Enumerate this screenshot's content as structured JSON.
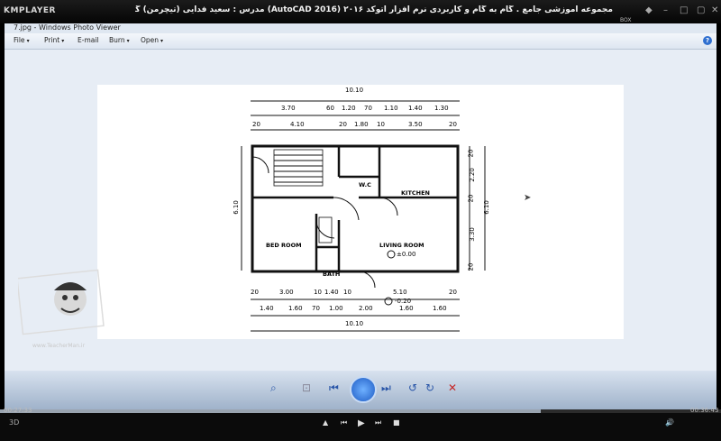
{
  "player": {
    "logo": "KMPLAYER",
    "title": "مجموعه آموزشی جامع . گام به گام و کاربردی نرم افزار  اتوکد ۲۰۱۶ (AutoCAD 2016)  مدرس : سعید فدایی (تیچرمن) گروه آموزشی پادشاه گرافیست ها",
    "box_label": "BOX",
    "time_elapsed": "00:27:33",
    "time_total": "00:36:43",
    "progress": 0.75
  },
  "viewer": {
    "title": "7.jpg - Windows Photo Viewer",
    "menu": [
      "File",
      "Print",
      "E-mail",
      "Burn",
      "Open"
    ],
    "help": "?"
  },
  "plan": {
    "top_dims_total": "10.10",
    "top_dims_row1": [
      "3.70",
      "60",
      "1.20",
      "70",
      "1.10",
      "1.40",
      "1.30"
    ],
    "top_dims_row2": [
      "20",
      "4.10",
      "20",
      "1.80",
      "10",
      "3.50",
      "20"
    ],
    "bottom_dims_row1": [
      "20",
      "3.00",
      "10",
      "1.40",
      "10",
      "5.10",
      "20"
    ],
    "bottom_dims_row2": [
      "1.40",
      "1.60",
      "70",
      "1.00",
      "2.00",
      "1.60",
      "1.60"
    ],
    "bottom_dims_total": "10.10",
    "left_dim": "6.10",
    "right_dims_row1": [
      "20",
      "2.20",
      "20",
      "3.30",
      "20"
    ],
    "right_dim_total": "6.10",
    "rooms": {
      "wc": "W.C",
      "kitchen": "KITCHEN",
      "bedroom": "BED ROOM",
      "living": "LIVING ROOM",
      "bath": "BATH"
    },
    "levels": {
      "inside": "±0.00",
      "outside": "-0.20"
    }
  },
  "watermark": {
    "site": "www.TeacherMan.ir"
  }
}
